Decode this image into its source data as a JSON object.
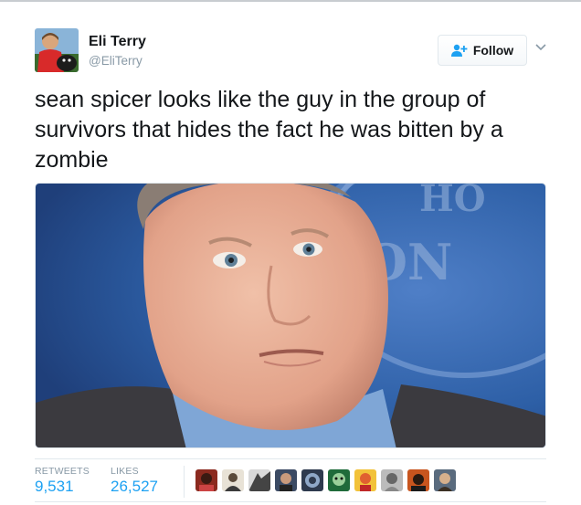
{
  "user": {
    "name": "Eli Terry",
    "handle": "@EliTerry"
  },
  "follow_label": "Follow",
  "tweet": {
    "text": "sean spicer looks like the guy in the group of survivors that hides the fact he was bitten by a zombie"
  },
  "stats": {
    "retweets_label": "RETWEETS",
    "retweets_value": "9,531",
    "likes_label": "LIKES",
    "likes_value": "26,527"
  },
  "colors": {
    "link_blue": "#1da1f2",
    "muted_gray": "#8899a6",
    "podium_blue": "#2d5fa6"
  },
  "icons": {
    "follow": "person-plus-icon",
    "caret": "chevron-down-icon"
  }
}
